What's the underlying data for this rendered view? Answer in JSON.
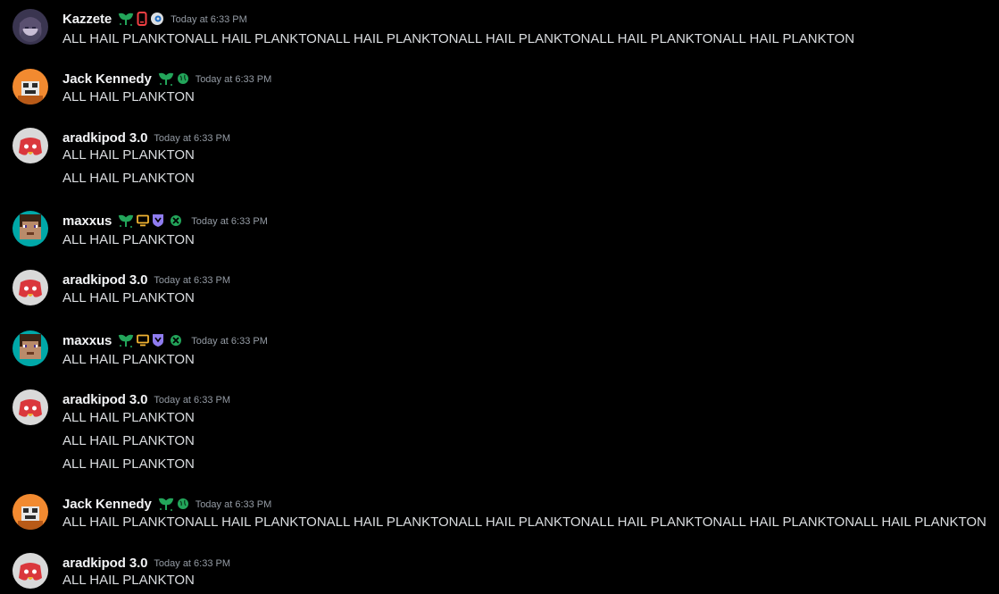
{
  "messages": [
    {
      "author": "Kazzete",
      "avatar": "anime-avatar",
      "badges": [
        "sprout-icon",
        "mobile-phone-icon",
        "spotify-status-icon"
      ],
      "timestamp": "Today at 6:33 PM",
      "lines": [
        "ALL HAIL PLANKTONALL HAIL PLANKTONALL HAIL PLANKTONALL HAIL PLANKTONALL HAIL PLANKTONALL HAIL PLANKTON"
      ]
    },
    {
      "author": "Jack Kennedy",
      "avatar": "orange-pixel-avatar",
      "badges": [
        "sprout-icon",
        "globe-icon"
      ],
      "timestamp": "Today at 6:33 PM",
      "lines": [
        "ALL HAIL PLANKTON"
      ]
    },
    {
      "author": "aradkipod 3.0",
      "avatar": "red-discord-avatar",
      "badges": [],
      "timestamp": "Today at 6:33 PM",
      "lines": [
        "ALL HAIL PLANKTON",
        "ALL HAIL PLANKTON"
      ]
    },
    {
      "author": "maxxus",
      "avatar": "minecraft-steve-avatar",
      "badges": [
        "sprout-icon",
        "desktop-icon",
        "shield-badge-icon",
        "xbox-icon"
      ],
      "timestamp": "Today at 6:33 PM",
      "lines": [
        "ALL HAIL PLANKTON"
      ]
    },
    {
      "author": "aradkipod 3.0",
      "avatar": "red-discord-avatar",
      "badges": [],
      "timestamp": "Today at 6:33 PM",
      "lines": [
        "ALL HAIL PLANKTON"
      ]
    },
    {
      "author": "maxxus",
      "avatar": "minecraft-steve-avatar",
      "badges": [
        "sprout-icon",
        "desktop-icon",
        "shield-badge-icon",
        "xbox-icon"
      ],
      "timestamp": "Today at 6:33 PM",
      "lines": [
        "ALL HAIL PLANKTON"
      ]
    },
    {
      "author": "aradkipod 3.0",
      "avatar": "red-discord-avatar",
      "badges": [],
      "timestamp": "Today at 6:33 PM",
      "lines": [
        "ALL HAIL PLANKTON",
        "ALL HAIL PLANKTON",
        "ALL HAIL PLANKTON"
      ]
    },
    {
      "author": "Jack Kennedy",
      "avatar": "orange-pixel-avatar",
      "badges": [
        "sprout-icon",
        "globe-icon"
      ],
      "timestamp": "Today at 6:33 PM",
      "lines": [
        "ALL HAIL PLANKTONALL HAIL PLANKTONALL HAIL PLANKTONALL HAIL PLANKTONALL HAIL PLANKTONALL HAIL PLANKTONALL HAIL PLANKTON"
      ]
    },
    {
      "author": "aradkipod 3.0",
      "avatar": "red-discord-avatar",
      "badges": [],
      "timestamp": "Today at 6:33 PM",
      "lines": [
        "ALL HAIL PLANKTON"
      ]
    }
  ],
  "colors": {
    "background": "#000000",
    "username": "#f2f3f5",
    "message_text": "#dbdee1",
    "timestamp": "#949ba4",
    "sprout_green": "#23a55a",
    "phone_red": "#f23f43",
    "desktop_orange": "#f0b232",
    "shield_purple": "#8f7cf0"
  }
}
